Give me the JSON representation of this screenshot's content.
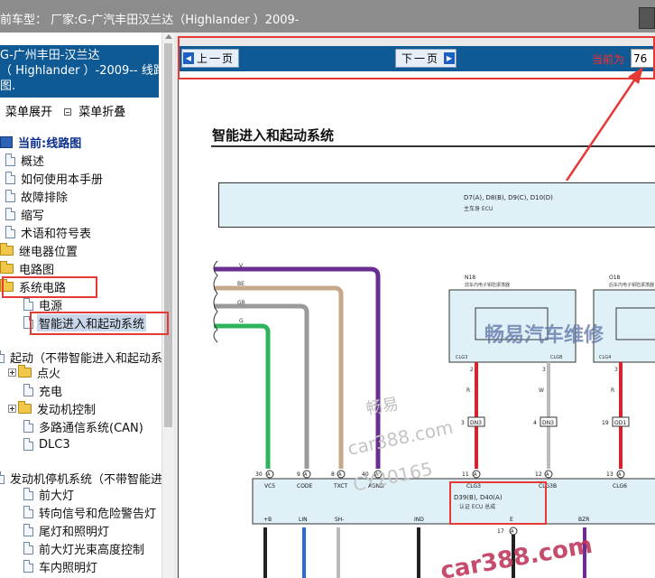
{
  "topbar": {
    "title": "前车型：  厂家:G-广汽丰田汉兰达（Highlander ）2009-"
  },
  "left": {
    "header_lines": [
      "G-广州丰田-汉兰达",
      "（ Highlander ）-2009-- 线路",
      "图."
    ],
    "menu_expand": "菜单展开",
    "menu_collapse": "菜单折叠",
    "tree": [
      {
        "label": "当前:线路图",
        "icon": "book-icon",
        "type": "current"
      },
      {
        "label": "概述",
        "icon": "document-icon"
      },
      {
        "label": "如何使用本手册",
        "icon": "document-icon"
      },
      {
        "label": "故障排除",
        "icon": "document-icon"
      },
      {
        "label": "缩写",
        "icon": "document-icon"
      },
      {
        "label": "术语和符号表",
        "icon": "document-icon"
      },
      {
        "label": "继电器位置",
        "icon": "folder-icon"
      },
      {
        "label": "电路图",
        "icon": "folder-icon"
      },
      {
        "label": "系统电路",
        "icon": "folder-icon"
      },
      {
        "label": "电源",
        "icon": "document-icon"
      },
      {
        "label": "智能进入和起动系统",
        "icon": "document-icon",
        "type": "selected"
      },
      {
        "label": "起动（不带智能进入和起动系统",
        "icon": "document-icon"
      },
      {
        "label": "点火",
        "icon": "folder-icon",
        "expander": "plus"
      },
      {
        "label": "充电",
        "icon": "document-icon"
      },
      {
        "label": "发动机控制",
        "icon": "folder-icon",
        "expander": "plus"
      },
      {
        "label": "多路通信系统(CAN)",
        "icon": "document-icon"
      },
      {
        "label": "DLC3",
        "icon": "document-icon"
      },
      {
        "label": "发动机停机系统（不带智能进入和",
        "icon": "document-icon"
      },
      {
        "label": "前大灯",
        "icon": "document-icon"
      },
      {
        "label": "转向信号和危险警告灯",
        "icon": "document-icon"
      },
      {
        "label": "尾灯和照明灯",
        "icon": "document-icon"
      },
      {
        "label": "前大灯光束高度控制",
        "icon": "document-icon"
      },
      {
        "label": "车内照明灯",
        "icon": "document-icon"
      }
    ]
  },
  "nav": {
    "prev_label": "上一页",
    "next_label": "下一页",
    "current_label": "当前为",
    "page_value": "76"
  },
  "document": {
    "title": "智能进入和起动系统",
    "ecu_top_line1": "D7(A), D8(B), D9(C), D10(D)",
    "ecu_top_line2": "主车身 ECU",
    "n18_code": "N18",
    "n18_name": "前车内电子钥匙振荡器",
    "o18_code": "O18",
    "o18_name": "后车内电子钥匙振荡器",
    "wire_colors": [
      "V",
      "BE",
      "GR",
      "G"
    ],
    "ecu_bottom_line1": "D39(B), D40(A)",
    "ecu_bottom_line2": "认证 ECU 总成",
    "pins_top": [
      {
        "num": "30",
        "pin": "A",
        "name": "VC5",
        "wire": "G"
      },
      {
        "num": "9",
        "pin": "A",
        "name": "CODE",
        "wire": "GR"
      },
      {
        "num": "8",
        "pin": "A",
        "name": "TXCT",
        "wire": "BE"
      },
      {
        "num": "40",
        "pin": "A",
        "name": "AGND",
        "wire": "V"
      },
      {
        "num": "11",
        "pin": "A",
        "name": "CLG3",
        "wire": ""
      },
      {
        "num": "12",
        "pin": "A",
        "name": "CLG3B",
        "wire": ""
      },
      {
        "num": "13",
        "pin": "A",
        "name": "CLG6",
        "wire": ""
      }
    ],
    "pins_bottom": [
      "+B",
      "LIN",
      "SH-",
      "IND",
      "E",
      "BZR"
    ],
    "pin_17": "17",
    "connector_labels": [
      "DN3",
      "DN3",
      "OD1"
    ],
    "connector_nums": [
      "3",
      "4",
      "19"
    ],
    "wire_labels_short": [
      "R",
      "W",
      "R"
    ],
    "clg_labels": [
      "CLG3",
      "CLGB",
      "CLG4"
    ],
    "watermark_cn": "畅易汽车维修",
    "watermark_small": "畅易",
    "watermark_url": "car388.com",
    "watermark_code": "CY20165",
    "watermark_footer": "car388.com"
  },
  "colors": {
    "nav_bg": "#0f5a94",
    "highlight_red": "#e53935",
    "wire_v": "#6a2e91",
    "wire_be": "#c6a98a",
    "wire_gr": "#9a9a9a",
    "wire_g": "#2fb35c",
    "wire_r": "#d8232a"
  }
}
